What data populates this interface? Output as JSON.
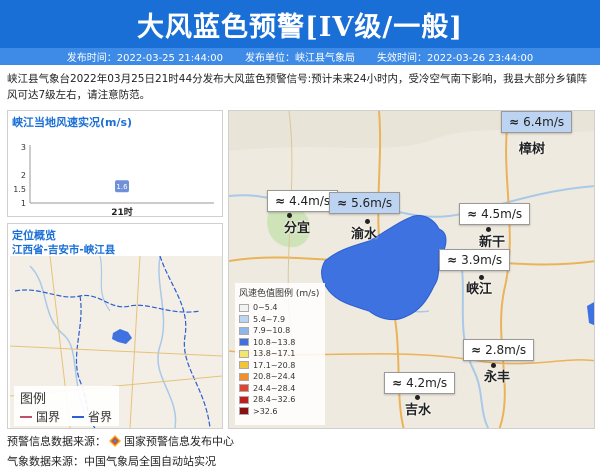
{
  "title": "大风蓝色预警[IV级/一般]",
  "meta": {
    "publish_time": "发布时间：2022-03-25 21:44:00",
    "publisher": "发布单位：峡江县气象局",
    "expire_time": "失效时间：2022-03-26 23:44:00"
  },
  "description": "峡江县气象台2022年03月25日21时44分发布大风蓝色预警信号:预计未来24小时内，受冷空气南下影响，我县大部分乡镇阵风可达7级左右，请注意防范。",
  "wind_panel": {
    "title": "峡江当地风速实况(m/s)"
  },
  "chart_data": {
    "type": "scatter",
    "categories": [
      "21时"
    ],
    "values": [
      1.6
    ],
    "ylim": [
      1,
      3
    ],
    "yticks": [
      "3",
      "2",
      "1.5",
      "1"
    ],
    "value_labels": [
      "1.6"
    ],
    "color": "#6f8fd8"
  },
  "overview": {
    "title": "定位概览",
    "path": "江西省-吉安市-峡江县",
    "legend_title": "图例",
    "legend_items": [
      {
        "label": "国界",
        "color": "#c0506a"
      },
      {
        "label": "省界",
        "color": "#2c5fd1"
      }
    ]
  },
  "speed_legend": {
    "title": "风速色值图例 (m/s)",
    "items": [
      {
        "label": "0~5.4",
        "color": "#f2f2f2"
      },
      {
        "label": "5.4~7.9",
        "color": "#bcd4f2"
      },
      {
        "label": "7.9~10.8",
        "color": "#8fb6ea"
      },
      {
        "label": "10.8~13.8",
        "color": "#3d72e0"
      },
      {
        "label": "13.8~17.1",
        "color": "#f4e66a"
      },
      {
        "label": "17.1~20.8",
        "color": "#f2c43a"
      },
      {
        "label": "20.8~24.4",
        "color": "#f08f2c"
      },
      {
        "label": "24.4~28.4",
        "color": "#e0442c"
      },
      {
        "label": "28.4~32.6",
        "color": "#c01e1e"
      },
      {
        "label": ">32.6",
        "color": "#8a0f0f"
      }
    ]
  },
  "stations": [
    {
      "name": "樟树",
      "speed": "6.4m/s",
      "highlight": true
    },
    {
      "name": "分宜",
      "speed": "4.4m/s",
      "highlight": false
    },
    {
      "name": "渝水",
      "speed": "5.6m/s",
      "highlight": true
    },
    {
      "name": "新干",
      "speed": "4.5m/s",
      "highlight": false
    },
    {
      "name": "峡江",
      "speed": "3.9m/s",
      "highlight": false
    },
    {
      "name": "永丰",
      "speed": "2.8m/s",
      "highlight": false
    },
    {
      "name": "吉水",
      "speed": "4.2m/s",
      "highlight": false
    }
  ],
  "footer": {
    "warning_source": "预警信息数据来源：",
    "warning_source_name": "国家预警信息发布中心",
    "weather_source": "气象数据来源：中国气象局全国自动站实况"
  },
  "colors": {
    "primary": "#1a6fd6",
    "secondary": "#3d8be6",
    "warning_area": "#3d72e0"
  }
}
